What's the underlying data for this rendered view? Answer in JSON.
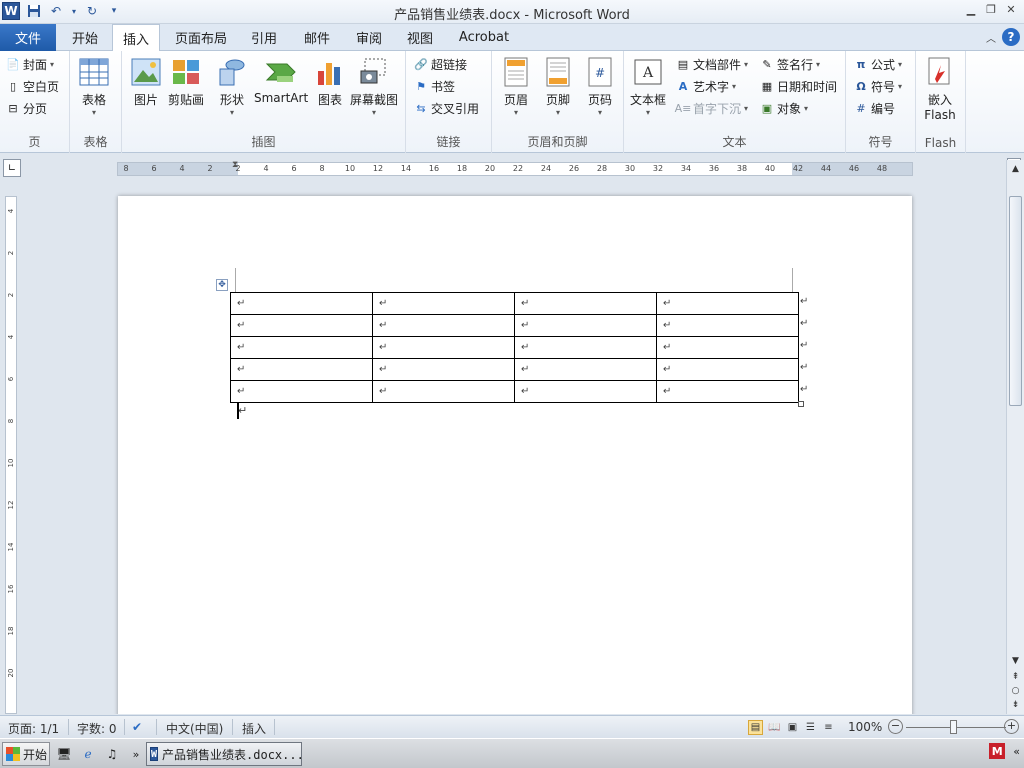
{
  "window": {
    "title": "产品销售业绩表.docx  -  Microsoft Word",
    "app_logo": "W"
  },
  "tabs": {
    "file": "文件",
    "items": [
      "开始",
      "插入",
      "页面布局",
      "引用",
      "邮件",
      "审阅",
      "视图",
      "Acrobat"
    ],
    "active": "插入"
  },
  "ribbon": {
    "page_group": {
      "label": "页",
      "cover": "封面",
      "blank_page": "空白页",
      "page_break": "分页"
    },
    "table_group": {
      "label": "表格",
      "table": "表格"
    },
    "illustrations_group": {
      "label": "插图",
      "picture": "图片",
      "clipart": "剪贴画",
      "shapes": "形状",
      "smartart": "SmartArt",
      "chart": "图表",
      "screenshot": "屏幕截图"
    },
    "links_group": {
      "label": "链接",
      "hyperlink": "超链接",
      "bookmark": "书签",
      "cross_ref": "交叉引用"
    },
    "header_footer_group": {
      "label": "页眉和页脚",
      "header": "页眉",
      "footer": "页脚",
      "page_number": "页码"
    },
    "text_group": {
      "label": "文本",
      "textbox": "文本框",
      "quick_parts": "文档部件",
      "wordart": "艺术字",
      "dropcap": "首字下沉",
      "signature": "签名行",
      "datetime": "日期和时间",
      "object": "对象"
    },
    "symbols_group": {
      "label": "符号",
      "equation": "公式",
      "symbol": "符号",
      "number": "编号"
    },
    "flash_group": {
      "label": "Flash",
      "embed": "嵌入",
      "flash": "Flash"
    }
  },
  "ruler": {
    "ticks": [
      "8",
      "6",
      "4",
      "2",
      "2",
      "4",
      "6",
      "8",
      "10",
      "12",
      "14",
      "16",
      "18",
      "20",
      "22",
      "24",
      "26",
      "28",
      "30",
      "32",
      "34",
      "36",
      "38",
      "40",
      "42",
      "44",
      "46",
      "48"
    ],
    "vticks": [
      "4",
      "2",
      "2",
      "4",
      "6",
      "8",
      "10",
      "12",
      "14",
      "16",
      "18",
      "20"
    ]
  },
  "document": {
    "table": {
      "rows": 5,
      "cols": 4,
      "cell_mark": "↵"
    },
    "paragraph_mark": "↵"
  },
  "status": {
    "page": "页面: 1/1",
    "words": "字数: 0",
    "language": "中文(中国)",
    "mode": "插入",
    "zoom": "100%"
  },
  "taskbar": {
    "start": "开始",
    "task_label": "产品销售业绩表.docx..."
  }
}
